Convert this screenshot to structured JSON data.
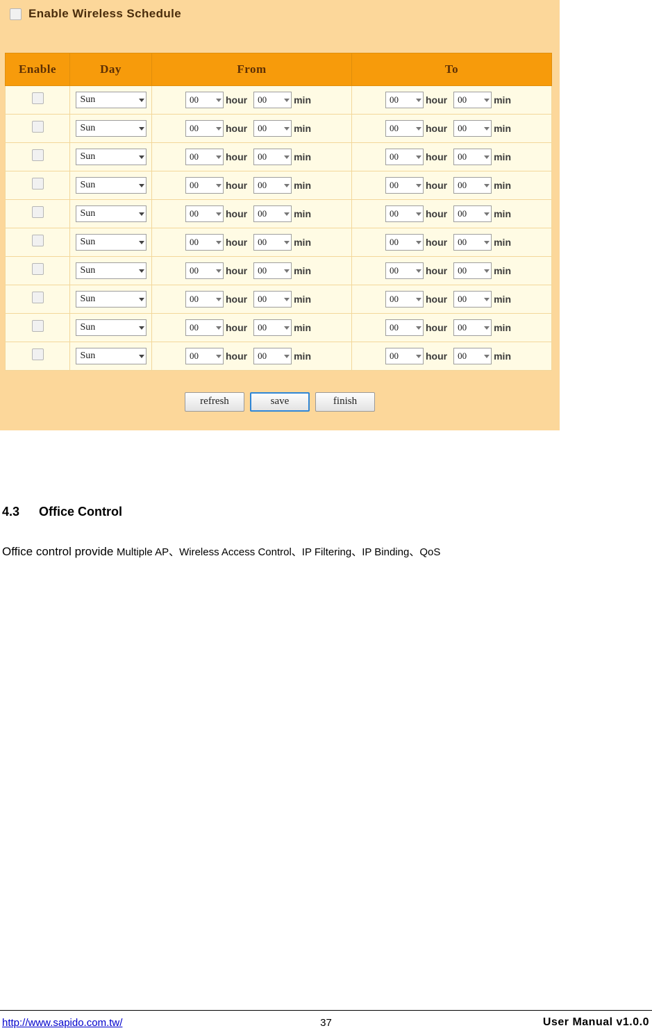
{
  "panel": {
    "enable_schedule_label": "Enable Wireless Schedule",
    "enable_schedule_checked": false,
    "columns": [
      "Enable",
      "Day",
      "From",
      "To"
    ],
    "unit_hour": "hour",
    "unit_min": "min",
    "rows": [
      {
        "enabled": false,
        "day": "Sun",
        "from_hour": "00",
        "from_min": "00",
        "to_hour": "00",
        "to_min": "00"
      },
      {
        "enabled": false,
        "day": "Sun",
        "from_hour": "00",
        "from_min": "00",
        "to_hour": "00",
        "to_min": "00"
      },
      {
        "enabled": false,
        "day": "Sun",
        "from_hour": "00",
        "from_min": "00",
        "to_hour": "00",
        "to_min": "00"
      },
      {
        "enabled": false,
        "day": "Sun",
        "from_hour": "00",
        "from_min": "00",
        "to_hour": "00",
        "to_min": "00"
      },
      {
        "enabled": false,
        "day": "Sun",
        "from_hour": "00",
        "from_min": "00",
        "to_hour": "00",
        "to_min": "00"
      },
      {
        "enabled": false,
        "day": "Sun",
        "from_hour": "00",
        "from_min": "00",
        "to_hour": "00",
        "to_min": "00"
      },
      {
        "enabled": false,
        "day": "Sun",
        "from_hour": "00",
        "from_min": "00",
        "to_hour": "00",
        "to_min": "00"
      },
      {
        "enabled": false,
        "day": "Sun",
        "from_hour": "00",
        "from_min": "00",
        "to_hour": "00",
        "to_min": "00"
      },
      {
        "enabled": false,
        "day": "Sun",
        "from_hour": "00",
        "from_min": "00",
        "to_hour": "00",
        "to_min": "00"
      },
      {
        "enabled": false,
        "day": "Sun",
        "from_hour": "00",
        "from_min": "00",
        "to_hour": "00",
        "to_min": "00"
      }
    ],
    "buttons": {
      "refresh": "refresh",
      "save": "save",
      "finish": "finish"
    }
  },
  "document": {
    "section_number": "4.3",
    "section_title": "Office Control",
    "paragraph_lead": "Office control provide ",
    "paragraph_items": "Multiple AP、Wireless Access Control、IP Filtering、IP Binding、QoS"
  },
  "footer": {
    "url": "http://www.sapido.com.tw/",
    "page": "37",
    "manual": "User  Manual  v1.0.0"
  }
}
